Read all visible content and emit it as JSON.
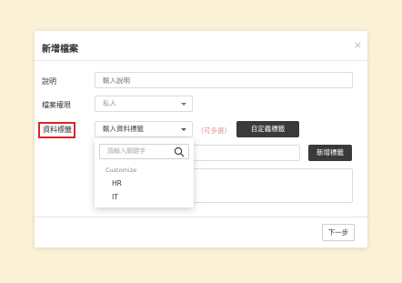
{
  "modal": {
    "title": "新增檔案",
    "close": "×"
  },
  "form": {
    "description": {
      "label": "說明",
      "placeholder": "輸入說明"
    },
    "permission": {
      "label": "檔案權限",
      "value": "私人"
    },
    "tags": {
      "label": "資料標籤",
      "select_value": "輸入資料標籤",
      "hint": "(可多選)",
      "custom_button": "自定義標籤",
      "add_button": "新增標籤"
    }
  },
  "dropdown": {
    "search_placeholder": "請輸入關鍵字",
    "group_label": "Customize",
    "items": [
      "HR",
      "IT"
    ]
  },
  "footer": {
    "next_button": "下一步"
  },
  "colors": {
    "background": "#fbf1d6",
    "highlight_border": "#d9242a",
    "dark_button": "#3a3a3a",
    "hint_text": "#e3988f"
  }
}
